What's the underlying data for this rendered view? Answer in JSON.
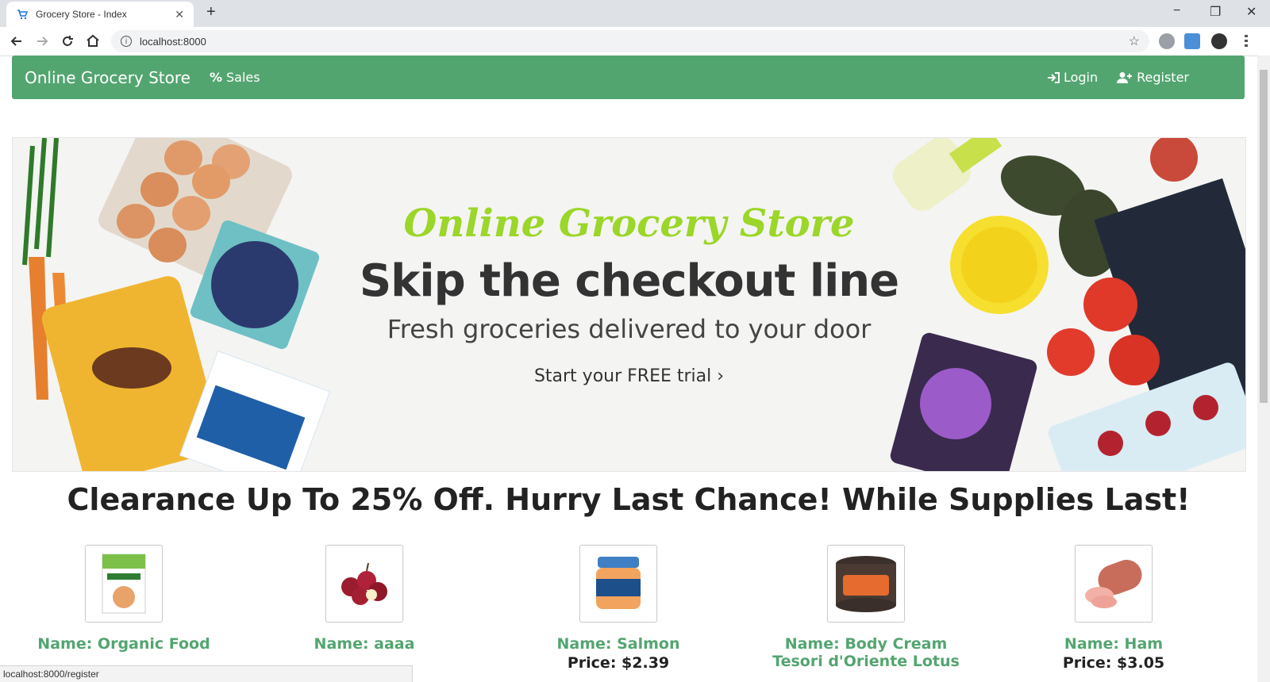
{
  "browser": {
    "tab_title": "Grocery Store - Index",
    "new_tab_symbol": "+",
    "url": "localhost:8000",
    "status_url": "localhost:8000/register",
    "controls": {
      "minimize": "−",
      "restore": "❐",
      "close": "✕"
    }
  },
  "navbar": {
    "brand": "Online Grocery Store",
    "sales": "Sales",
    "login": "Login",
    "register": "Register",
    "color": "#53a570"
  },
  "banner": {
    "script_title": "Online Grocery Store",
    "headline": "Skip the checkout line",
    "subheadline": "Fresh groceries delivered to your door",
    "cta": "Start your FREE trial ›"
  },
  "clearance": "Clearance Up To 25% Off. Hurry Last Chance! While Supplies Last!",
  "products": [
    {
      "name": "Name: Organic Food",
      "price": "",
      "image": "organic-food-box"
    },
    {
      "name": "Name: aaaa",
      "price": "",
      "image": "cherries"
    },
    {
      "name": "Name: Salmon",
      "price": "Price: $2.39",
      "image": "salmon-jar"
    },
    {
      "name": "Name: Body Cream Tesori d'Oriente Lotus",
      "price": "",
      "image": "body-cream-jar"
    },
    {
      "name": "Name: Ham",
      "price": "Price: $3.05",
      "image": "ham"
    }
  ]
}
